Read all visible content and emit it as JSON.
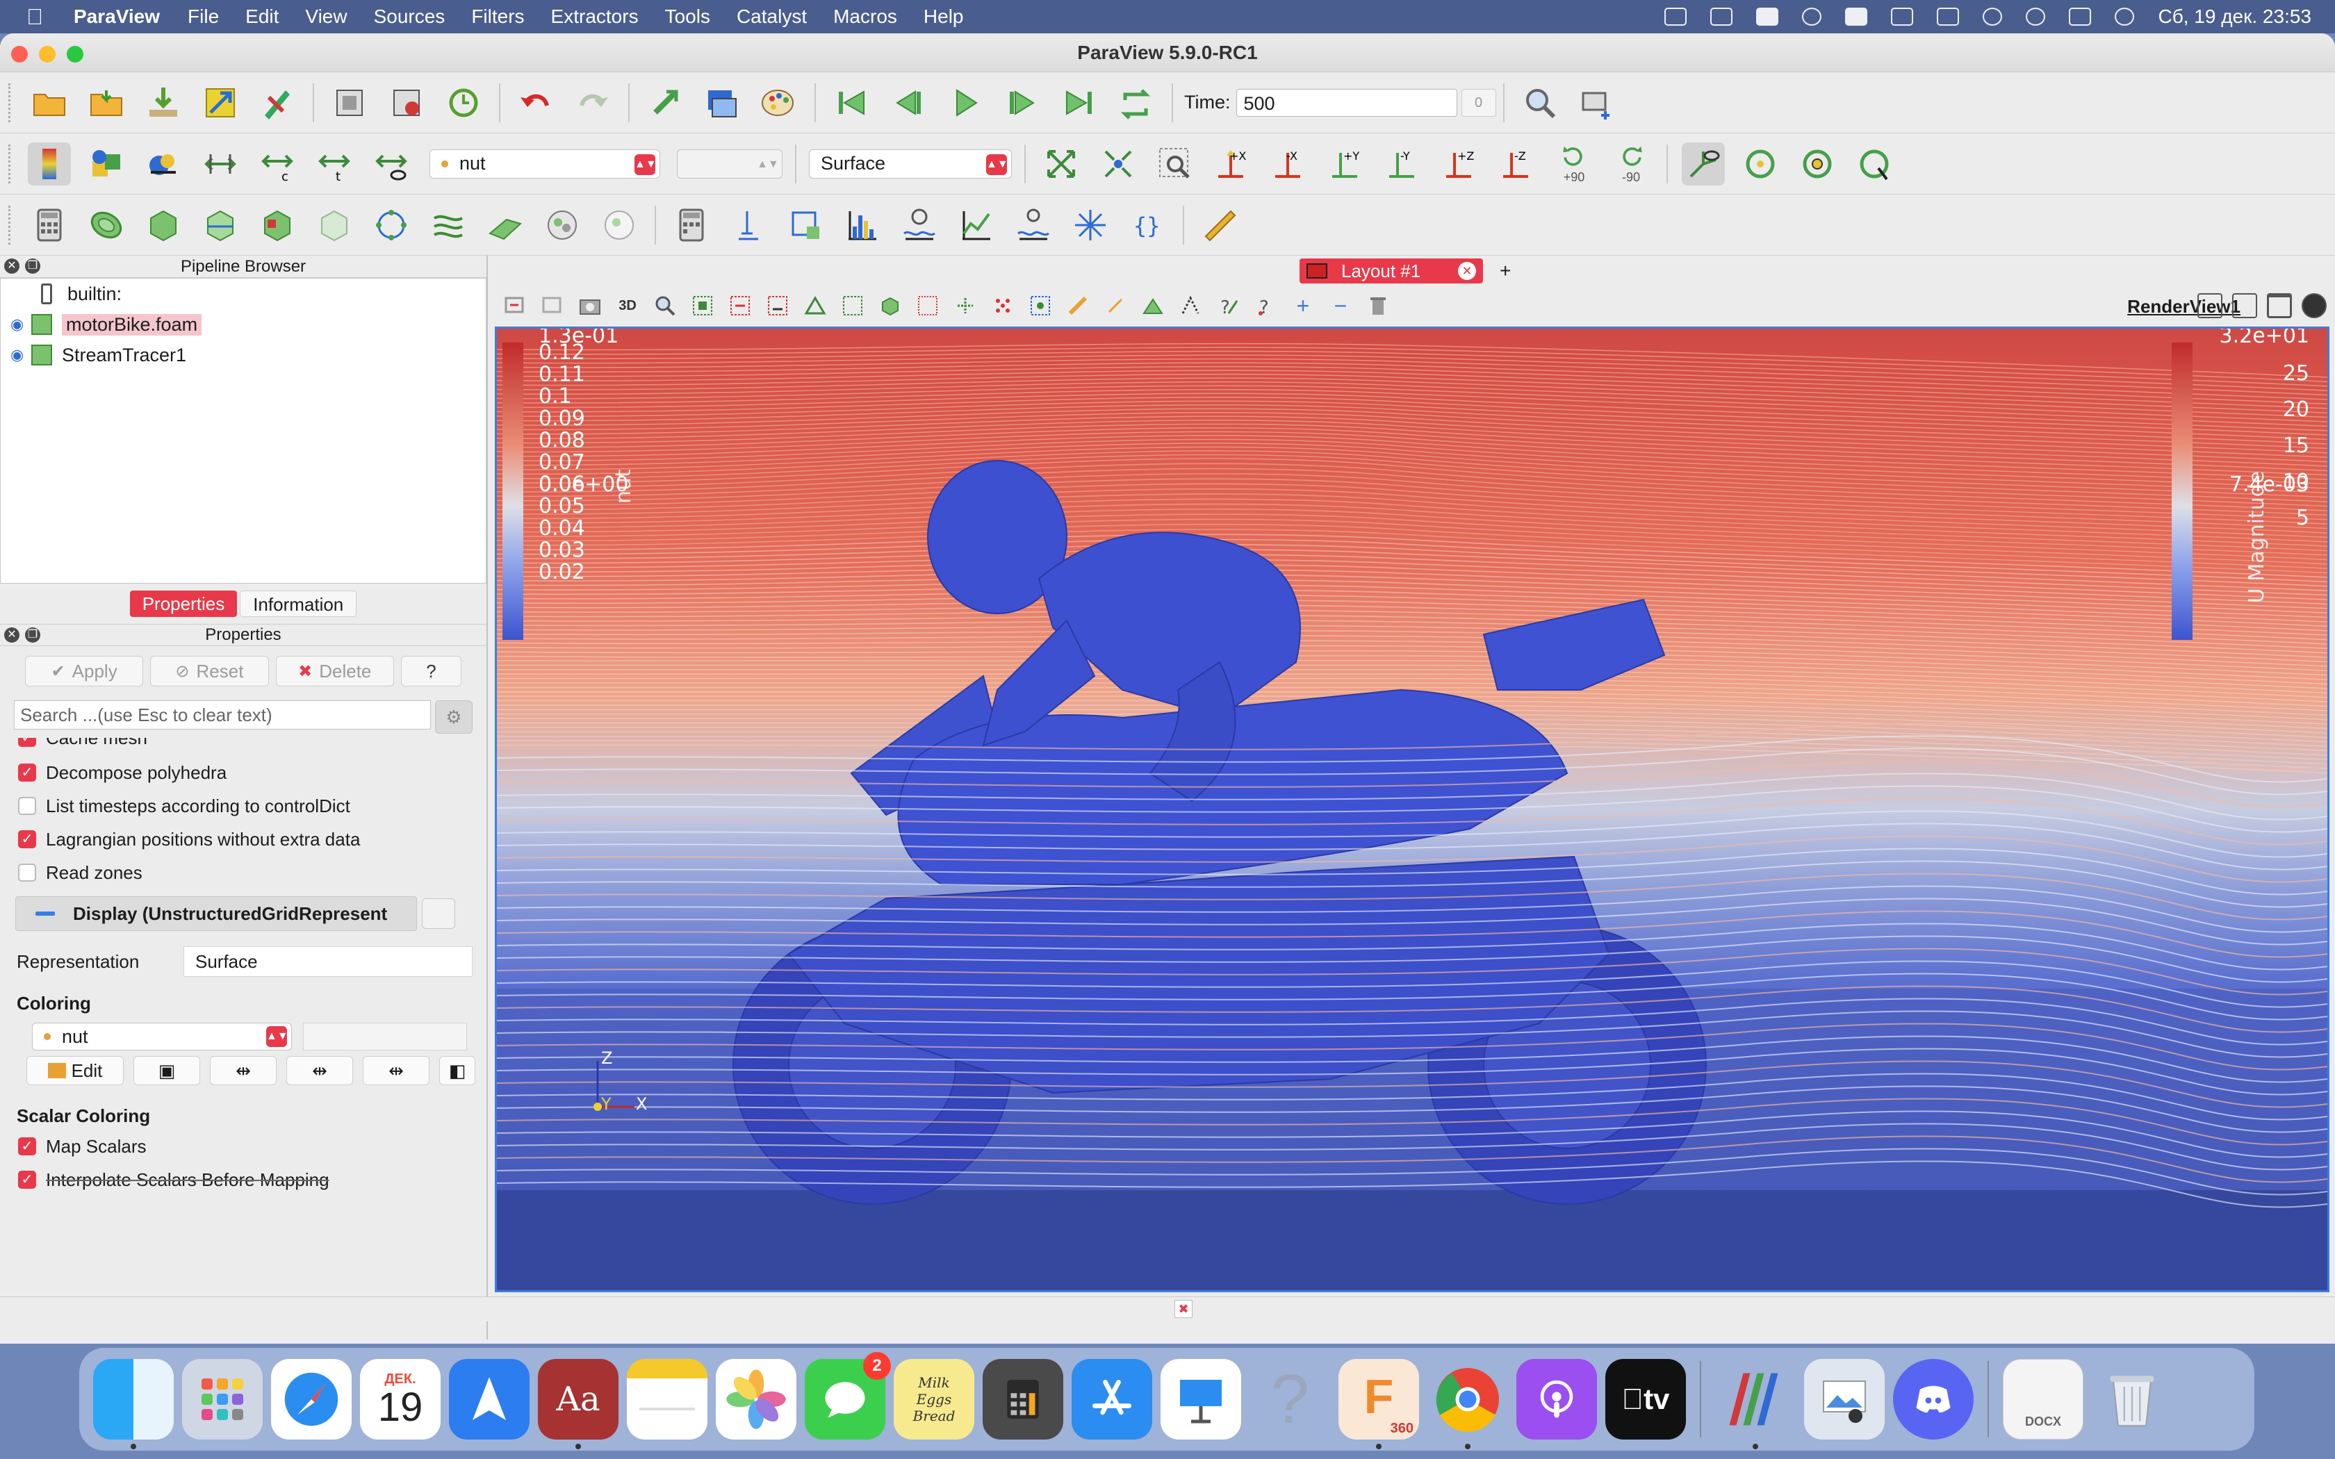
{
  "menubar": {
    "app_name": "ParaView",
    "items": [
      "File",
      "Edit",
      "View",
      "Sources",
      "Filters",
      "Extractors",
      "Tools",
      "Catalyst",
      "Macros",
      "Help"
    ],
    "clock": "Сб, 19 дек.  23:53"
  },
  "window": {
    "title": "ParaView 5.9.0-RC1"
  },
  "toolbar": {
    "time_label": "Time:",
    "time_value": "500",
    "time_index": "0",
    "array_combo": "nut",
    "component_combo": "",
    "representation_combo": "Surface",
    "rotate_plus_90": "+90",
    "rotate_minus_90": "-90"
  },
  "pipeline_browser": {
    "title": "Pipeline Browser",
    "items": [
      {
        "label": "builtin:"
      },
      {
        "label": "motorBike.foam"
      },
      {
        "label": "StreamTracer1"
      }
    ]
  },
  "properties_panel": {
    "tabs": [
      "Properties",
      "Information"
    ],
    "title": "Properties",
    "apply": "Apply",
    "reset": "Reset",
    "delete": "Delete",
    "help": "?",
    "search_placeholder": "Search ...(use Esc to clear text)",
    "partial_row": "Cache mesh",
    "checkboxes": [
      {
        "label": "Decompose polyhedra",
        "checked": true
      },
      {
        "label": "List timesteps according to controlDict",
        "checked": false
      },
      {
        "label": "Lagrangian positions without extra data",
        "checked": true
      },
      {
        "label": "Read zones",
        "checked": false
      }
    ],
    "display_section": "Display (UnstructuredGridRepresent",
    "representation_label": "Representation",
    "representation_value": "Surface",
    "coloring_label": "Coloring",
    "coloring_value": "nut",
    "edit_label": "Edit",
    "scalar_coloring_label": "Scalar Coloring",
    "map_scalars": "Map Scalars",
    "interpolate": "Interpolate Scalars Before Mapping"
  },
  "layout": {
    "tab_label": "Layout #1",
    "add_tab": "+",
    "view_toolbar_3d": "3D",
    "render_view_name": "RenderView1"
  },
  "render": {
    "left_bar": {
      "title": "nut",
      "labels": [
        "1.3e-01",
        "0.12",
        "0.11",
        "0.1",
        "0.09",
        "0.08",
        "0.07",
        "0.06",
        "0.05",
        "0.04",
        "0.03",
        "0.02",
        "0.0e+00"
      ]
    },
    "right_bar": {
      "title": "U Magnitude",
      "labels": [
        "3.2e+01",
        "25",
        "20",
        "15",
        "10",
        "5",
        "7.4e-03"
      ]
    },
    "axes": {
      "z": "Z",
      "y": "Y",
      "x": "X"
    }
  },
  "dock": {
    "calendar_month": "ДЕК.",
    "calendar_day": "19",
    "messages_badge": "2",
    "notes_text": "Milk Eggs Bread",
    "fusion_text": "360",
    "help_glyph": "?",
    "dictionary_text": "Aa",
    "tv_text": "tv",
    "docx_text": "DOCX"
  },
  "colors": {
    "accent": "#e8394a",
    "selection_blue": "#3a7de0",
    "model_blue": "#3d4fc9",
    "background_bottom": "#3b4ea5",
    "background_top": "#d8554a"
  }
}
